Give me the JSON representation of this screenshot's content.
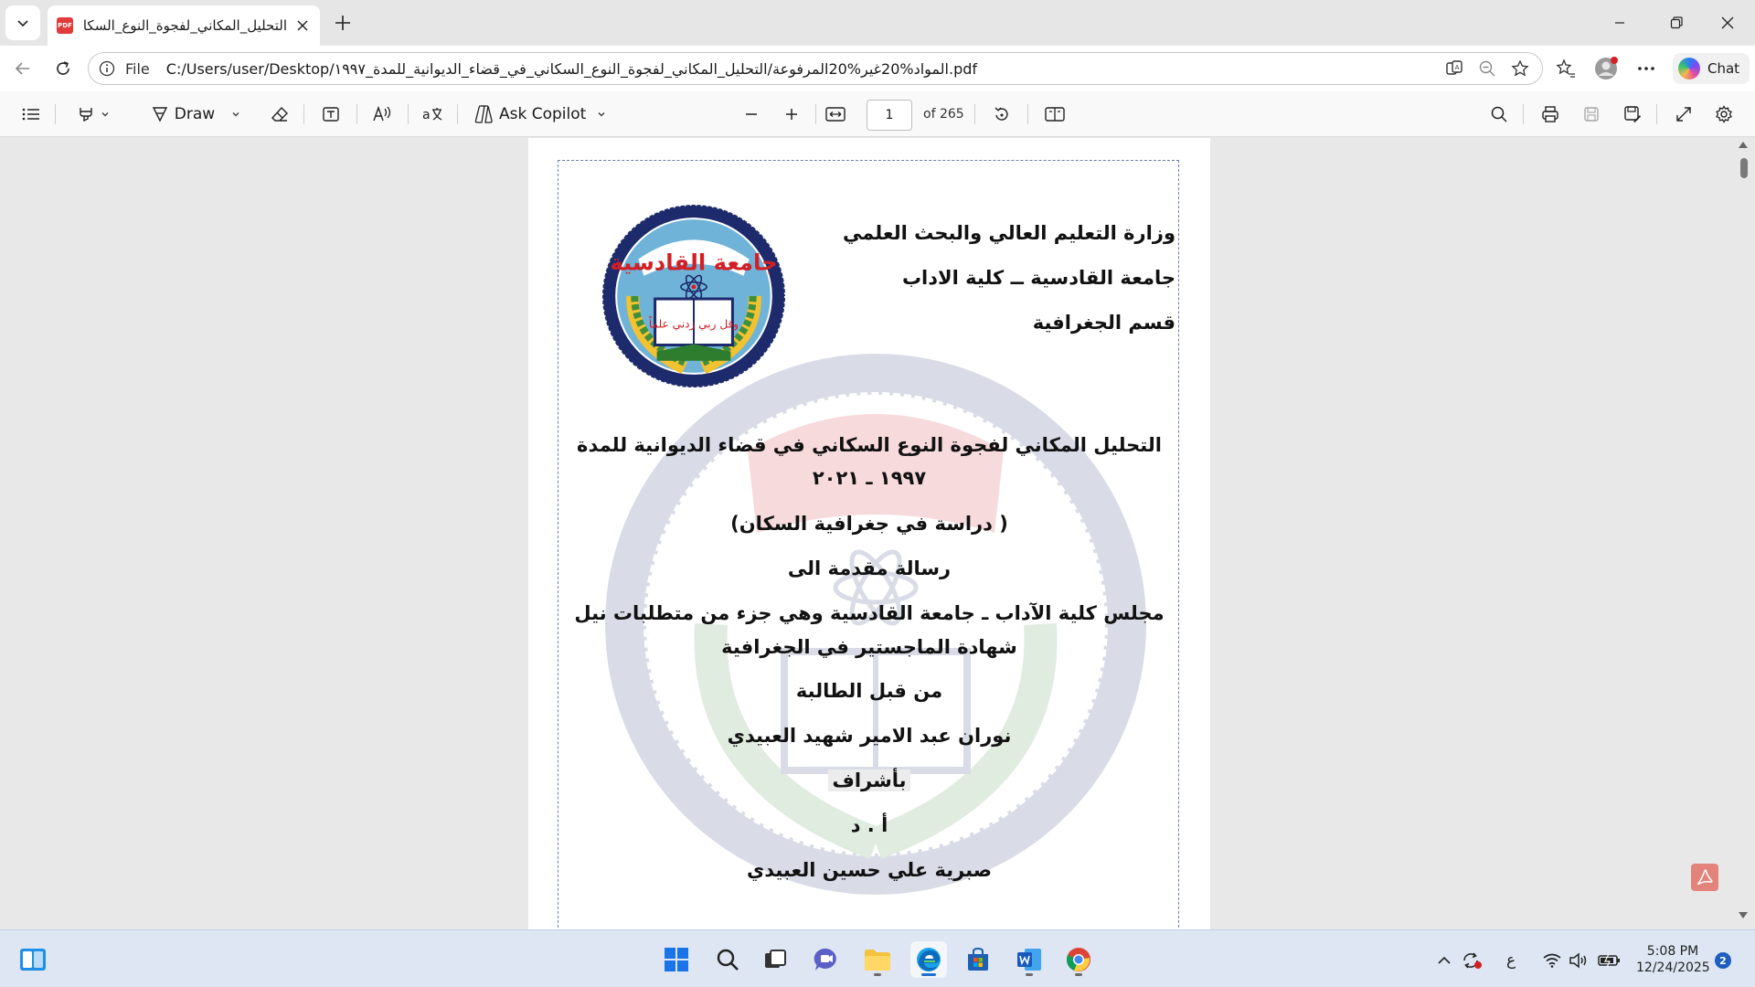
{
  "browser": {
    "tab": {
      "favicon": "PDF",
      "title": "التحليل_المكاني_لفجوة_النوع_السكاني"
    },
    "address": {
      "scheme": "File",
      "url": "C:/Users/user/Desktop/المواد%20غير%20المرفوعة/التحليل_المكاني_لفجوة_النوع_السكاني_في_قضاء_الديوانية_للمدة_١٩٩٧.pdf"
    },
    "chat_label": "Chat"
  },
  "pdf_toolbar": {
    "draw_label": "Draw",
    "copilot_label": "Ask Copilot",
    "page_number": "1",
    "page_total": "of 265"
  },
  "document": {
    "ministry": "وزارة التعليم العالي والبحث العلمي",
    "university": "جامعة القادسية ــ كلية الاداب",
    "department": "قسم الجغرافية",
    "title_line1": "التحليل المكاني لفجوة النوع السكاني في قضاء الديوانية للمدة",
    "title_line2": "١٩٩٧ ـ ٢٠٢١",
    "study": "( دراسة في جغرافية السكان)",
    "thesis": "رسالة مقدمة الى",
    "council_line1": "مجلس كلية الآداب ـ جامعة القادسية وهي جزء من متطلبات نيل",
    "council_line2": "شهادة الماجستير في الجغرافية",
    "by": "من قبل الطالبة",
    "student": "نوران عبد الامير شهيد العبيدي",
    "supervision": "بأشراف",
    "prof_title": "أ . د",
    "supervisor": "صبرية علي حسين العبيدي",
    "seal_text_top": "جامعة القادسية",
    "seal_text_book": "وقل ربي زدني علماً"
  },
  "taskbar": {
    "clock_time": "5:08 PM",
    "clock_date": "12/24/2025",
    "language": "ع",
    "notification_count": "2"
  },
  "colors": {
    "tab_strip": "#e6e6e6",
    "viewer_bg": "#e8e8e8",
    "seal_navy": "#1d2a6b",
    "seal_green": "#3f8f3c",
    "seal_red": "#d21f26",
    "accent_blue": "#1f6fd0"
  }
}
